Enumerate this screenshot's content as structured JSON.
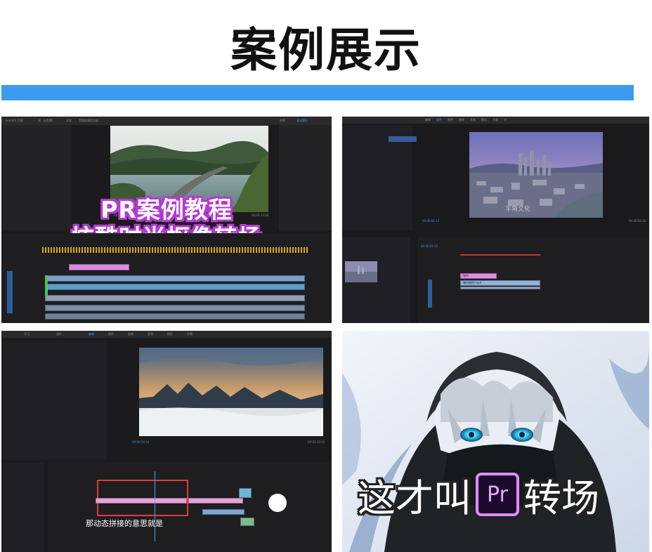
{
  "page": {
    "heading": "案例展示",
    "accent_color": "#3b9bf0"
  },
  "case1": {
    "title_line1": "PR案例教程",
    "title_line2": "炫酷时尚抠像转场",
    "outline_color": "#b33bd1",
    "menu_items": [
      "Lumetri 范围",
      "源（无剪辑）",
      "文本",
      "音频剪辑混合器"
    ],
    "tabs": [
      "效果",
      "基本图形"
    ],
    "timecode": "00:01:13:04",
    "duration": "00:01:13:04"
  },
  "case2": {
    "watermark": "羊角文化",
    "menu_items": [
      "编辑",
      "组件",
      "颜色",
      "效果",
      "音频",
      "图形",
      "字幕",
      "库"
    ],
    "timecode_left": "00:00:01:15",
    "timecode_right": "00:00:02:18",
    "seq_timecode": "00:00:01:15",
    "clip_labels": [
      "城市",
      "城市航拍.mp4"
    ]
  },
  "case3": {
    "subtitle": "那动态拼接的意思就是",
    "timecode_left": "00:00:14:14",
    "timecode_right": "00:01:13:03",
    "zoom": "适合",
    "menu_items": [
      "学习",
      "组件",
      "编辑",
      "颜色",
      "效果",
      "音频",
      "图形",
      "字幕"
    ]
  },
  "case4": {
    "caption_before": "这才叫",
    "logo_text": "Pr",
    "caption_after": "转场"
  }
}
